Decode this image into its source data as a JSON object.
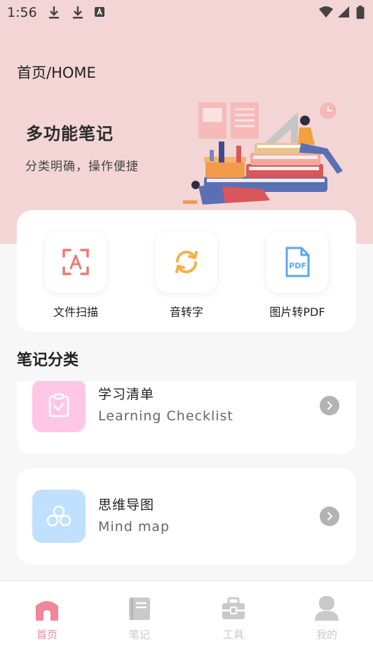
{
  "status_bar": {
    "time": "1:56",
    "icons": [
      "download-icon",
      "download-icon",
      "text-a-icon",
      "wifi-icon",
      "signal-icon",
      "battery-icon"
    ]
  },
  "header": {
    "title": "首页/HOME"
  },
  "hero": {
    "title": "多功能笔记",
    "subtitle": "分类明确，操作便捷",
    "background": "#f3d5d5"
  },
  "tools": [
    {
      "label": "文件扫描",
      "icon": "scan-icon",
      "color": "#f07872"
    },
    {
      "label": "音转字",
      "icon": "convert-icon",
      "color": "#f5b04a"
    },
    {
      "label": "图片转PDF",
      "icon": "pdf-icon",
      "color": "#5aa6f0"
    }
  ],
  "categories_section": {
    "title": "笔记分类"
  },
  "categories": [
    {
      "name": "学习清单",
      "subtitle": "Learning Checklist",
      "icon": "checklist-icon",
      "color": "#ffc6e5"
    },
    {
      "name": "思维导图",
      "subtitle": "Mind map",
      "icon": "mind-map-icon",
      "color": "#bfe1ff"
    }
  ],
  "bottom_nav": {
    "items": [
      {
        "label": "首页",
        "icon": "home-icon",
        "active": true
      },
      {
        "label": "笔记",
        "icon": "notebook-icon",
        "active": false
      },
      {
        "label": "工具",
        "icon": "toolbox-icon",
        "active": false
      },
      {
        "label": "我的",
        "icon": "user-icon",
        "active": false
      }
    ],
    "active_color": "#f0869a",
    "inactive_color": "#c9c9c9"
  }
}
